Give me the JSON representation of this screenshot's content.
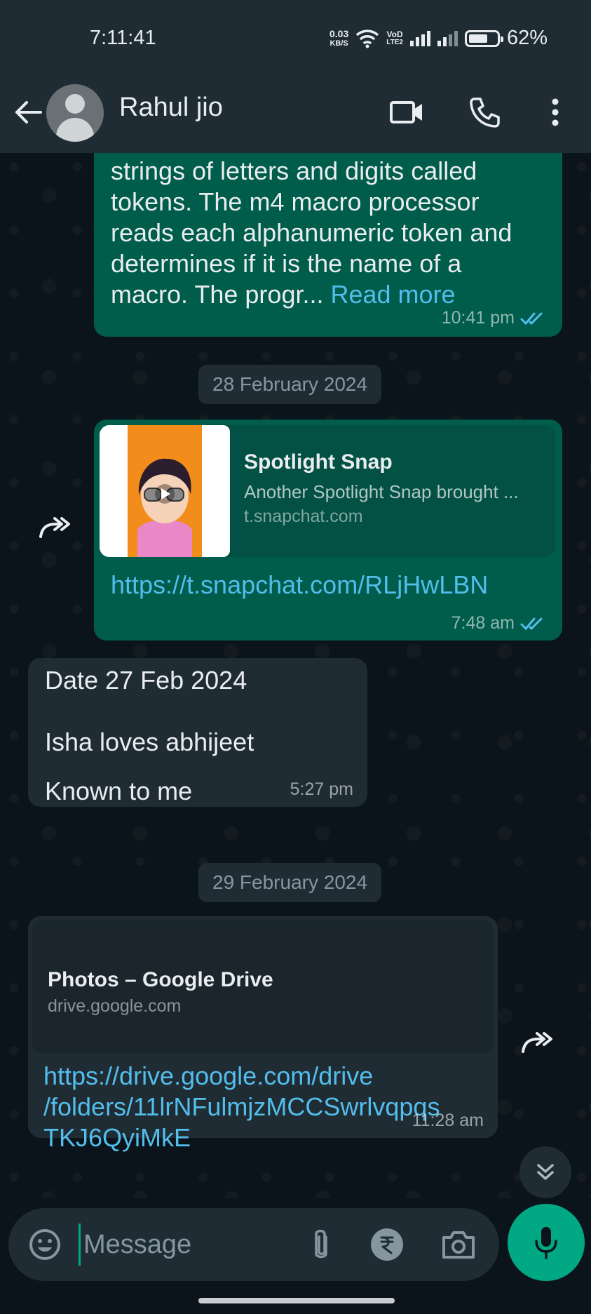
{
  "status_bar": {
    "time": "7:11:41",
    "net_speed_value": "0.03",
    "net_speed_unit": "KB/S",
    "volte_top": "VoD",
    "volte_bottom": "LTE2",
    "battery": "62%"
  },
  "header": {
    "contact_name": "Rahul jio",
    "icons": [
      "back-arrow-icon",
      "avatar",
      "video-call-icon",
      "phone-icon",
      "more-options-icon"
    ]
  },
  "messages": [
    {
      "direction": "outgoing",
      "text_lines": [
        "strings of letters and digits called",
        "tokens. The m4 macro processor",
        "reads each alphanumeric token and",
        "determines if it is the name of a",
        "macro. The progr..."
      ],
      "read_more": "Read more",
      "time": "10:41 pm",
      "status": "read"
    },
    {
      "type": "date",
      "label": "28 February 2024"
    },
    {
      "direction": "outgoing",
      "preview_title": "Spotlight Snap",
      "preview_desc": "Another Spotlight Snap brought ...",
      "preview_domain": "t.snapchat.com",
      "link": "https://t.snapchat.com/RLjHwLBN",
      "time": "7:48 am",
      "status": "read"
    },
    {
      "direction": "incoming",
      "line1": "Date 27 Feb 2024",
      "line2": "Isha loves abhijeet",
      "line3": "Known to me",
      "time": "5:27 pm"
    },
    {
      "type": "date",
      "label": "29 February 2024"
    },
    {
      "direction": "incoming",
      "preview_title": "Photos – Google Drive",
      "preview_domain": "drive.google.com",
      "link_lines": [
        "https://drive.google.com/drive",
        "/folders/11lrNFulmjzMCCSwrlvqpqs",
        "TKJ6QyiMkE"
      ],
      "time": "11:28 am"
    }
  ],
  "composer": {
    "placeholder": "Message",
    "icons": [
      "emoji-icon",
      "attach-icon",
      "rupee-payment-icon",
      "camera-icon",
      "mic-icon"
    ]
  },
  "colors": {
    "outgoing_bubble": "#005c4b",
    "incoming_bubble": "#1f2c34",
    "accent": "#00a884",
    "link": "#53bdeb",
    "background": "#0b141a"
  }
}
